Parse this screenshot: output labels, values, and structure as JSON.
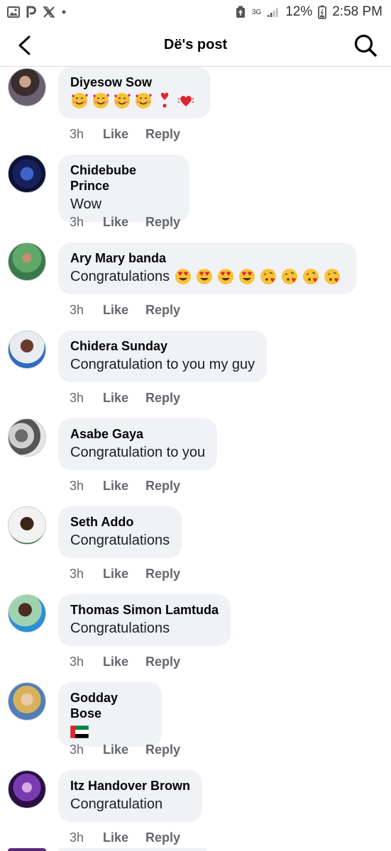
{
  "status_bar": {
    "time": "2:58 PM",
    "battery": "12%",
    "network": "3G"
  },
  "header": {
    "title": "Dë's post"
  },
  "actions": {
    "like": "Like",
    "reply": "Reply"
  },
  "comments": [
    {
      "author": "Diyesow Sow",
      "text": "",
      "emoji": [
        "smiling-face-with-hearts",
        "smiling-face-with-hearts",
        "smiling-face-with-hearts",
        "smiling-face-with-hearts",
        "exclamation-heart",
        "beating-heart"
      ],
      "time": "3h"
    },
    {
      "author": "Chidebube Prince",
      "text": "Wow",
      "emoji": [],
      "time": "3h"
    },
    {
      "author": "Ary Mary banda",
      "text": "Congratulations",
      "emoji": [
        "heart-eyes",
        "heart-eyes",
        "heart-eyes",
        "heart-eyes",
        "face-blowing-kiss",
        "face-blowing-kiss",
        "face-blowing-kiss",
        "face-blowing-kiss"
      ],
      "time": "3h"
    },
    {
      "author": "Chidera Sunday",
      "text": "Congratulation to you my guy",
      "emoji": [],
      "time": "3h"
    },
    {
      "author": "Asabe Gaya",
      "text": "Congratulation to you",
      "emoji": [],
      "time": "3h"
    },
    {
      "author": "Seth Addo",
      "text": "Congratulations",
      "emoji": [],
      "time": "3h"
    },
    {
      "author": "Thomas Simon Lamtuda",
      "text": "Congratulations",
      "emoji": [],
      "time": "3h"
    },
    {
      "author": "Godday Bose",
      "text": "",
      "emoji": [
        "uae-flag"
      ],
      "time": "3h"
    },
    {
      "author": "Itz Handover Brown",
      "text": "Congratulation",
      "emoji": [],
      "time": "3h"
    }
  ],
  "colors": {
    "bubble": "#f0f2f5",
    "meta": "#65676b",
    "text": "#050505"
  }
}
